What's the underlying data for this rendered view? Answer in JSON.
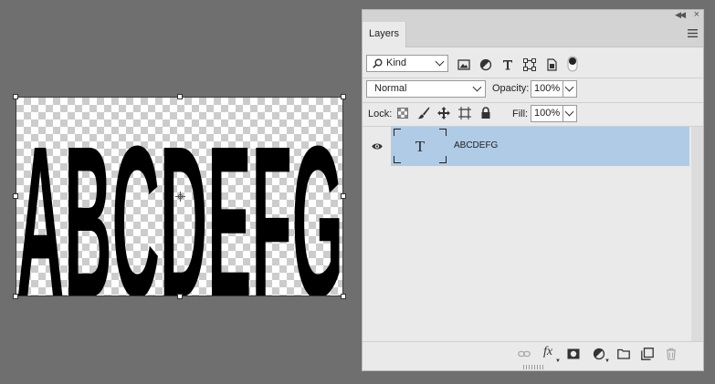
{
  "canvas": {
    "text_content": "ABCDEFG"
  },
  "panel": {
    "tab_label": "Layers",
    "collapse_icon": "double-chevron-icon",
    "close_icon": "close-icon",
    "menu_icon": "hamburger-menu-icon",
    "filter": {
      "kind_label": "Kind",
      "icons": [
        "pixel-filter-icon",
        "adjustment-filter-icon",
        "type-filter-icon",
        "shape-filter-icon",
        "smart-object-filter-icon",
        "filter-toggle-icon"
      ]
    },
    "blend_mode": "Normal",
    "opacity_label": "Opacity:",
    "opacity_value": "100%",
    "lock_label": "Lock:",
    "fill_label": "Fill:",
    "fill_value": "100%",
    "layers": [
      {
        "name": "ABCDEFG",
        "type": "text",
        "thumb_glyph": "T",
        "visible": true,
        "selected": true
      }
    ],
    "footer_icons": [
      "link-icon",
      "fx-icon",
      "mask-icon",
      "adjustment-icon",
      "folder-icon",
      "new-layer-icon",
      "trash-icon"
    ],
    "fx_label": "fx",
    "selected_color": "#b0cbe6"
  }
}
